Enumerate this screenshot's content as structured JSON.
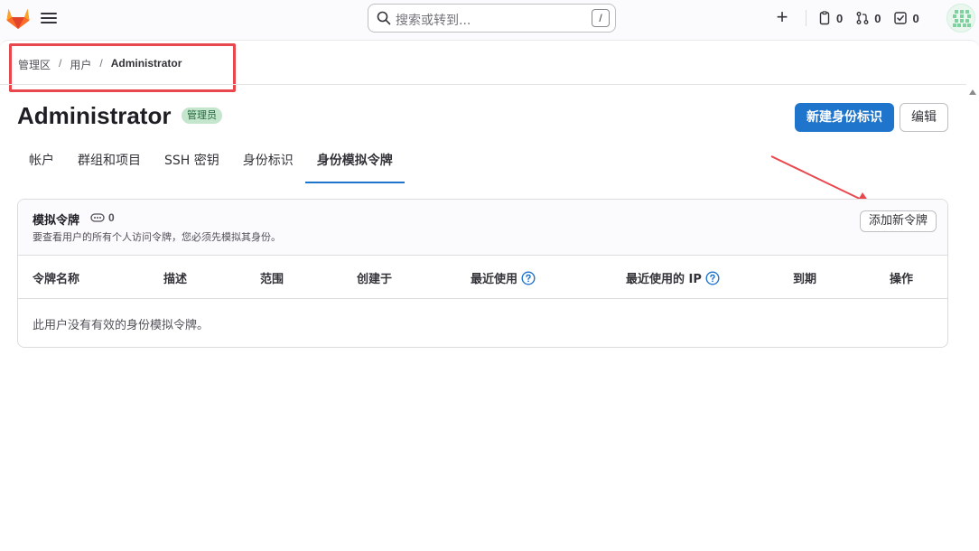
{
  "topbar": {
    "search_placeholder": "搜索或转到...",
    "search_shortcut": "/",
    "issues_count": "0",
    "merge_requests_count": "0",
    "todos_count": "0"
  },
  "breadcrumb": {
    "items": [
      "管理区",
      "用户"
    ],
    "current": "Administrator"
  },
  "page": {
    "title": "Administrator",
    "role_badge": "管理员",
    "primary_button": "新建身份标识",
    "edit_button": "编辑"
  },
  "tabs": [
    "帐户",
    "群组和项目",
    "SSH 密钥",
    "身份标识",
    "身份模拟令牌"
  ],
  "active_tab_index": 4,
  "tokens_card": {
    "title": "模拟令牌",
    "count": "0",
    "description": "要查看用户的所有个人访问令牌，您必须先模拟其身份。",
    "add_button": "添加新令牌",
    "columns": [
      "令牌名称",
      "描述",
      "范围",
      "创建于",
      "最近使用",
      "最近使用的 IP",
      "到期",
      "操作"
    ],
    "empty_message": "此用户没有有效的身份模拟令牌。"
  },
  "colors": {
    "primary": "#1f75cb",
    "highlight": "#e8474d",
    "badge_bg": "#c3e6cd",
    "badge_text": "#24663b"
  }
}
